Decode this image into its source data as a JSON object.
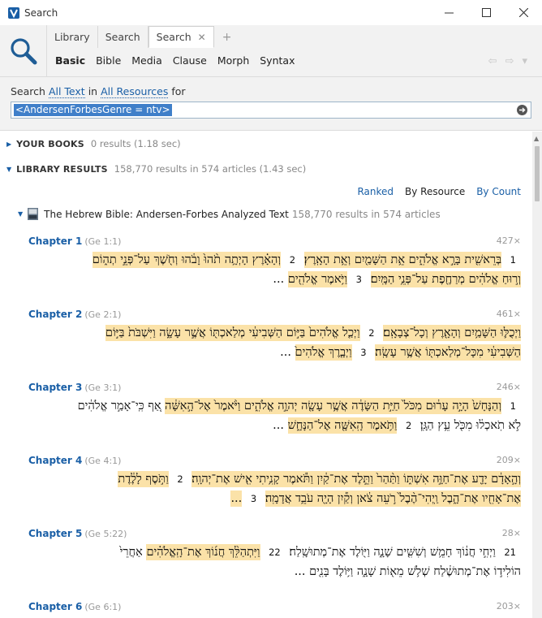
{
  "window": {
    "title": "Search"
  },
  "tabs": [
    {
      "label": "Library",
      "active": false
    },
    {
      "label": "Search",
      "active": false
    },
    {
      "label": "Search",
      "active": true
    }
  ],
  "subtabs": [
    "Basic",
    "Bible",
    "Media",
    "Clause",
    "Morph",
    "Syntax"
  ],
  "search_line": {
    "prefix": "Search",
    "scope": "All Text",
    "mid": "in",
    "resources": "All Resources",
    "suffix": "for"
  },
  "query": {
    "value": "<AndersenForbesGenre = ntv>"
  },
  "your_books": {
    "label": "YOUR BOOKS",
    "meta": "0 results (1.18 sec)"
  },
  "library_results": {
    "label": "LIBRARY RESULTS",
    "meta": "158,770 results in 574 articles (1.43 sec)"
  },
  "sort_options": [
    "Ranked",
    "By Resource",
    "By Count"
  ],
  "resource": {
    "name": "The Hebrew Bible: Andersen-Forbes Analyzed Text",
    "meta": "158,770 results in 574 articles"
  },
  "chapters": [
    {
      "title": "Chapter 1",
      "ref": "(Ge 1:1)",
      "count": "427×",
      "lines": [
        [
          {
            "t": "1",
            "k": "vn"
          },
          {
            "t": "בְּרֵאשִׁ֖ית בָּרָ֣א אֱלֹהִ֑ים אֵ֥ת הַשָּׁמַ֖יִם וְאֵ֥ת הָאָֽרֶץ׃",
            "k": "hl"
          },
          {
            "t": "2",
            "k": "vn"
          },
          {
            "t": "וְהָאָ֗רֶץ הָיְתָ֥ה תֹ֨הוּ֙ וָבֹ֔הוּ וְחֹ֖שֶׁךְ עַל־פְּנֵ֣י תְה֑וֹם",
            "k": "hl"
          }
        ],
        [
          {
            "t": "וְר֣וּחַ אֱלֹהִ֔ים מְרַחֶ֖פֶת עַל־פְּנֵ֥י הַמָּֽיִם׃",
            "k": "hl"
          },
          {
            "t": "3",
            "k": "vn"
          },
          {
            "t": "וַיֹּ֥אמֶר אֱלֹהִ֖ים",
            "k": "hl"
          },
          {
            "t": "...",
            "k": "tx"
          }
        ]
      ]
    },
    {
      "title": "Chapter 2",
      "ref": "(Ge 2:1)",
      "count": "461×",
      "lines": [
        [
          {
            "t": "וַיְכֻלּ֛וּ הַשָּׁמַ֥יִם וְהָאָ֖רֶץ וְכָל־צְבָאָֽם׃",
            "k": "hl"
          },
          {
            "t": "2",
            "k": "vn"
          },
          {
            "t": "וַיְכַ֤ל אֱלֹהִים֙ בַּיּ֣וֹם הַשְּׁבִיעִ֔י מְלַאכְתּ֖וֹ אֲשֶׁ֣ר עָשָׂ֑ה וַיִּשְׁבֹּת֙ בַּיּ֣וֹם",
            "k": "hl"
          }
        ],
        [
          {
            "t": "הַשְּׁבִיעִ֔י מִכָּל־מְלַאכְתּ֖וֹ אֲשֶׁ֥ר עָשָֽׂה׃",
            "k": "hl"
          },
          {
            "t": "3",
            "k": "vn"
          },
          {
            "t": "וַיְבָ֤רֶךְ אֱלֹהִים֙",
            "k": "hl"
          },
          {
            "t": "...",
            "k": "tx"
          }
        ]
      ]
    },
    {
      "title": "Chapter 3",
      "ref": "(Ge 3:1)",
      "count": "246×",
      "lines": [
        [
          {
            "t": "1",
            "k": "vn"
          },
          {
            "t": "וְהַנָּחָשׁ֙ הָיָ֣ה עָר֔וּם מִכֹּל֙ חַיַּ֣ת הַשָּׂדֶ֔ה אֲשֶׁ֥ר עָשָׂ֖ה יְהוָ֣ה אֱלֹהִ֑ים וַיֹּ֨אמֶר֙ אֶל־הָ֣אִשָּׁ֔ה",
            "k": "hl"
          },
          {
            "t": "אַ֚ף כִּֽי־אָמַ֣ר אֱלֹהִ֔ים",
            "k": "tx"
          }
        ],
        [
          {
            "t": "לֹ֣א תֹֽאכְל֔וּ מִכֹּ֖ל עֵ֥ץ הַגָּֽן׃",
            "k": "tx"
          },
          {
            "t": "2",
            "k": "vn"
          },
          {
            "t": "וַתֹּ֥אמֶר הָֽאִשָּׁ֖ה אֶל־הַנָּחָ֑שׁ",
            "k": "hl"
          },
          {
            "t": "...",
            "k": "tx"
          }
        ]
      ]
    },
    {
      "title": "Chapter 4",
      "ref": "(Ge 4:1)",
      "count": "209×",
      "lines": [
        [
          {
            "t": "וְהָ֣אָדָ֔ם יָדַ֖ע אֶת־חַוָּ֣ה אִשְׁתּ֑וֹ וַתַּ֨הַר֙ וַתֵּ֣לֶד אֶת־קַ֔יִן וַתֹּ֕אמֶר קָנִ֥יתִי אִ֖ישׁ אֶת־יְהוָֽה׃",
            "k": "hl"
          },
          {
            "t": "2",
            "k": "vn"
          },
          {
            "t": "וַתֹּ֣סֶף לָלֶ֔דֶת",
            "k": "hl"
          }
        ],
        [
          {
            "t": "אֶת־אָחִ֖יו אֶת־הָ֑בֶל וַֽיְהִי־הֶ֨בֶל֙ רֹ֣עֵה צֹ֔אן וְקַ֕יִן הָיָ֖ה עֹבֵ֥ד אֲדָמָֽה׃",
            "k": "hl"
          },
          {
            "t": "3",
            "k": "vn"
          },
          {
            "t": "...",
            "k": "hl"
          }
        ]
      ]
    },
    {
      "title": "Chapter 5",
      "ref": "(Ge 5:22)",
      "count": "28×",
      "lines": [
        [
          {
            "t": "21",
            "k": "vn"
          },
          {
            "t": "וַיְחִ֣י חֲנ֔וֹךְ חָמֵ֥שׁ וְשִׁשִּׁ֖ים שָׁנָ֑ה וַיּ֖וֹלֶד אֶת־מְתוּשָֽׁלַח׃",
            "k": "tx"
          },
          {
            "t": "22",
            "k": "vn"
          },
          {
            "t": "וַיִּתְהַלֵּ֨ךְ חֲנ֜וֹךְ אֶת־הָֽאֱלֹהִ֗ים",
            "k": "hl"
          },
          {
            "t": "אַחֲרֵי֙",
            "k": "tx"
          }
        ],
        [
          {
            "t": "הוֹלִיד֣וֹ אֶת־מְתוּשֶׁ֔לַח שְׁלֹ֥שׁ מֵא֖וֹת שָׁנָ֑ה וַיּ֥וֹלֶד בָּנִ֖ים",
            "k": "tx"
          },
          {
            "t": "...",
            "k": "tx"
          }
        ]
      ]
    },
    {
      "title": "Chapter 6",
      "ref": "(Ge 6:1)",
      "count": "203×",
      "lines": []
    }
  ]
}
